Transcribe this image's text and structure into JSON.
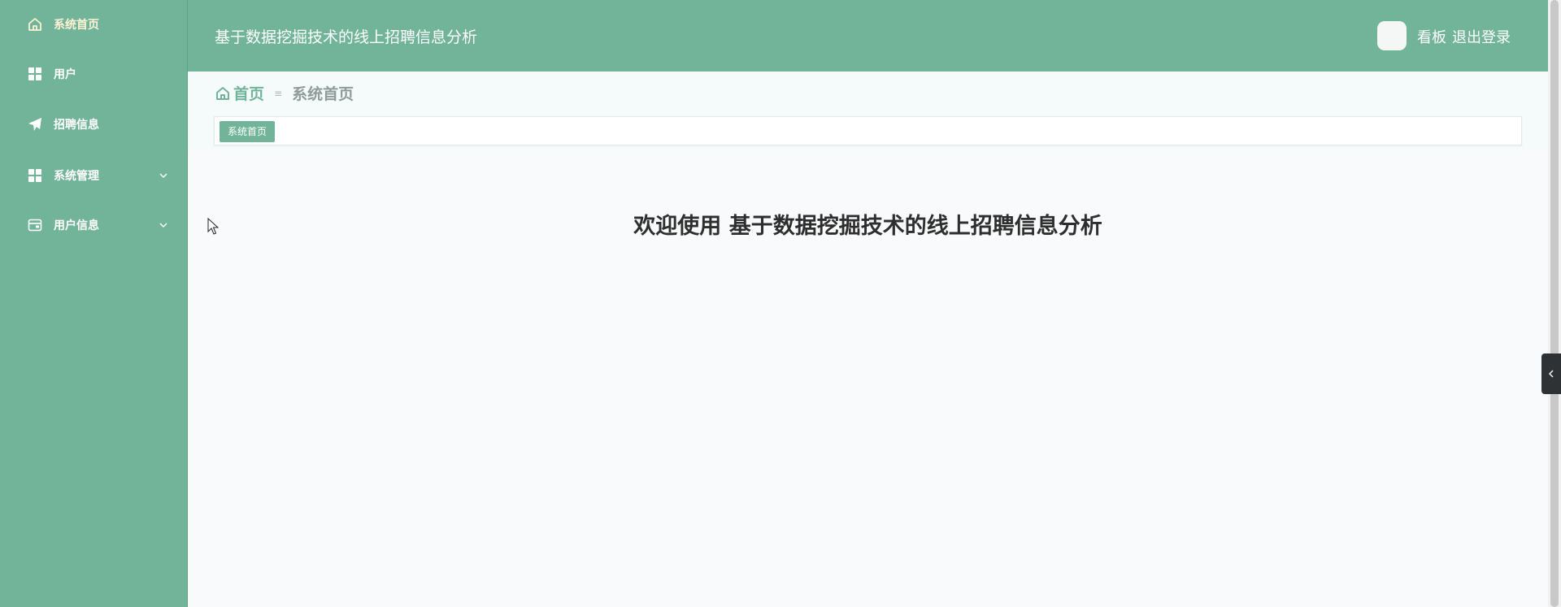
{
  "header": {
    "title": "基于数据挖掘技术的线上招聘信息分析",
    "board_link": "看板",
    "logout_link": "退出登录"
  },
  "sidebar": {
    "items": [
      {
        "label": "系统首页",
        "icon": "home-icon",
        "active": true
      },
      {
        "label": "用户",
        "icon": "grid-icon"
      },
      {
        "label": "招聘信息",
        "icon": "paper-plane-icon"
      },
      {
        "label": "系统管理",
        "icon": "grid-icon",
        "expandable": true
      },
      {
        "label": "用户信息",
        "icon": "wallet-icon",
        "expandable": true
      }
    ]
  },
  "breadcrumb": {
    "home": "首页",
    "separator": "≡",
    "current": "系统首页"
  },
  "tags": [
    {
      "label": "系统首页"
    }
  ],
  "main": {
    "welcome": "欢迎使用 基于数据挖掘技术的线上招聘信息分析"
  },
  "colors": {
    "primary": "#72b49a",
    "active_text": "#fdf2d3",
    "heading_text": "#2e2e2e"
  }
}
